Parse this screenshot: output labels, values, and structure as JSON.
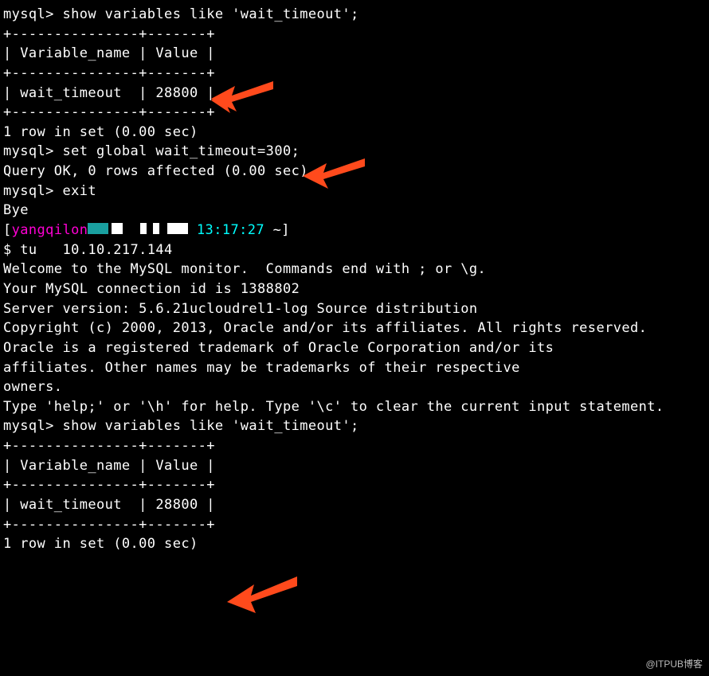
{
  "terminal": {
    "prompt1": "mysql> show variables like 'wait_timeout';",
    "tbl_border": "+---------------+-------+",
    "tbl_header": "| Variable_name | Value |",
    "tbl_row1": "| wait_timeout  | 28800 |",
    "rowcount1": "1 row in set (0.00 sec)",
    "blank": "",
    "prompt2": "mysql> set global wait_timeout=300;",
    "result2": "Query OK, 0 rows affected (0.00 sec)",
    "prompt3": "mysql> exit",
    "bye": "Bye",
    "shell_user": "yangqilon",
    "shell_time": "13:17:27",
    "shell_path": "~",
    "shell_open": "[",
    "shell_close": "]",
    "shell_cmd": "$ tu   10.10.217.144",
    "welcome1": "Welcome to the MySQL monitor.  Commands end with ; or \\g.",
    "welcome2": "Your MySQL connection id is 1388802",
    "welcome3": "Server version: 5.6.21ucloudrel1-log Source distribution",
    "copyright": "Copyright (c) 2000, 2013, Oracle and/or its affiliates. All rights reserved.",
    "oracle1": "Oracle is a registered trademark of Oracle Corporation and/or its",
    "oracle2": "affiliates. Other names may be trademarks of their respective",
    "oracle3": "owners.",
    "help": "Type 'help;' or '\\h' for help. Type '\\c' to clear the current input statement.",
    "prompt4": "mysql> show variables like 'wait_timeout';",
    "rowcount2": "1 row in set (0.00 sec)"
  },
  "watermark": "@ITPUB博客"
}
